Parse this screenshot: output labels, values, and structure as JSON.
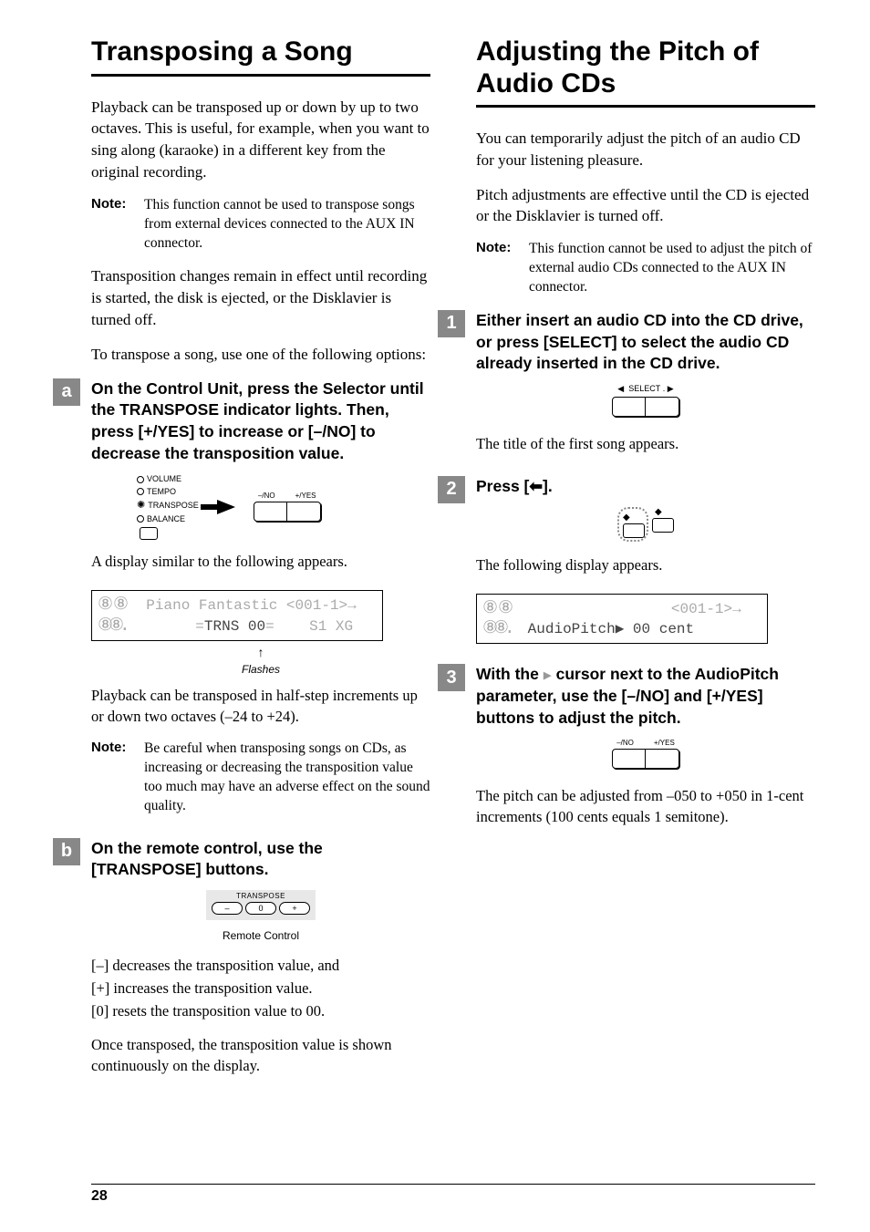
{
  "left": {
    "title": "Transposing a Song",
    "intro": "Playback can be transposed up or down by up to two octaves. This is useful, for example, when you want to sing along (karaoke) in a different key from the original recording.",
    "note1_label": "Note:",
    "note1_text": "This function cannot be used to transpose songs from external devices connected to the AUX IN connector.",
    "para2": "Transposition changes remain in effect until recording is started, the disk is ejected, or the Disklavier is turned off.",
    "para3": "To transpose a song, use one of the following options:",
    "step_a": {
      "letter": "a",
      "title": "On the Control Unit, press the Selector until the TRANSPOSE indicator lights. Then, press [+/YES] to increase or [–/NO] to decrease the transposition value.",
      "selector_labels": {
        "volume": "VOLUME",
        "tempo": "TEMPO",
        "transpose": "TRANSPOSE",
        "balance": "BALANCE"
      },
      "noyes": {
        "no": "–/NO",
        "yes": "+/YES"
      },
      "after1": "A display similar to the following appears.",
      "lcd_line1": "  Piano Fantastic <001-1>→",
      "lcd_line2_pre": "        =",
      "lcd_line2_mid": "TRNS 00",
      "lcd_line2_post": "=    S1 XG ",
      "flashes": "Flashes",
      "after2": "Playback can be transposed in half-step increments up or down two octaves (–24 to +24).",
      "note2_label": "Note:",
      "note2_text": "Be careful when transposing songs on CDs, as increasing or decreasing the transposition value too much may have an adverse effect on the sound quality."
    },
    "step_b": {
      "letter": "b",
      "title": "On the remote control, use the [TRANSPOSE] buttons.",
      "remote_label": "TRANSPOSE",
      "btn_minus": "–",
      "btn_zero": "0",
      "btn_plus": "+",
      "remote_caption": "Remote Control",
      "line1": "[–] decreases the transposition value, and",
      "line2": "[+] increases the transposition value.",
      "line3": "[0] resets the transposition value to 00.",
      "line4": "Once transposed, the transposition value is shown continuously on the display."
    }
  },
  "right": {
    "title": "Adjusting the Pitch of Audio CDs",
    "intro": "You can temporarily adjust the pitch of an audio CD for your listening pleasure.",
    "para2": "Pitch adjustments are effective until the CD is ejected or the Disklavier is turned off.",
    "note1_label": "Note:",
    "note1_text": "This function cannot be used to adjust the pitch of external audio CDs connected to the AUX IN connector.",
    "step1": {
      "num": "1",
      "title": "Either insert an audio CD into the CD drive, or press [SELECT] to select the audio CD already inserted in the CD drive.",
      "select_label": "SELECT",
      "after": "The title of the first song appears."
    },
    "step2": {
      "num": "2",
      "title": "Press [⬅].",
      "after": "The following display appears.",
      "lcd_line1": "                  <001-1>→",
      "lcd_line2": "  AudioPitch▶ 00 cent    "
    },
    "step3": {
      "num": "3",
      "title_p1": "With the ",
      "title_p2": " cursor next to the AudioPitch parameter, use the [–/NO] and [+/YES] buttons to adjust the pitch.",
      "noyes": {
        "no": "–/NO",
        "yes": "+/YES"
      },
      "after": "The pitch can be adjusted from –050 to +050 in 1-cent increments (100 cents equals 1 semitone)."
    }
  },
  "page_num": "28"
}
